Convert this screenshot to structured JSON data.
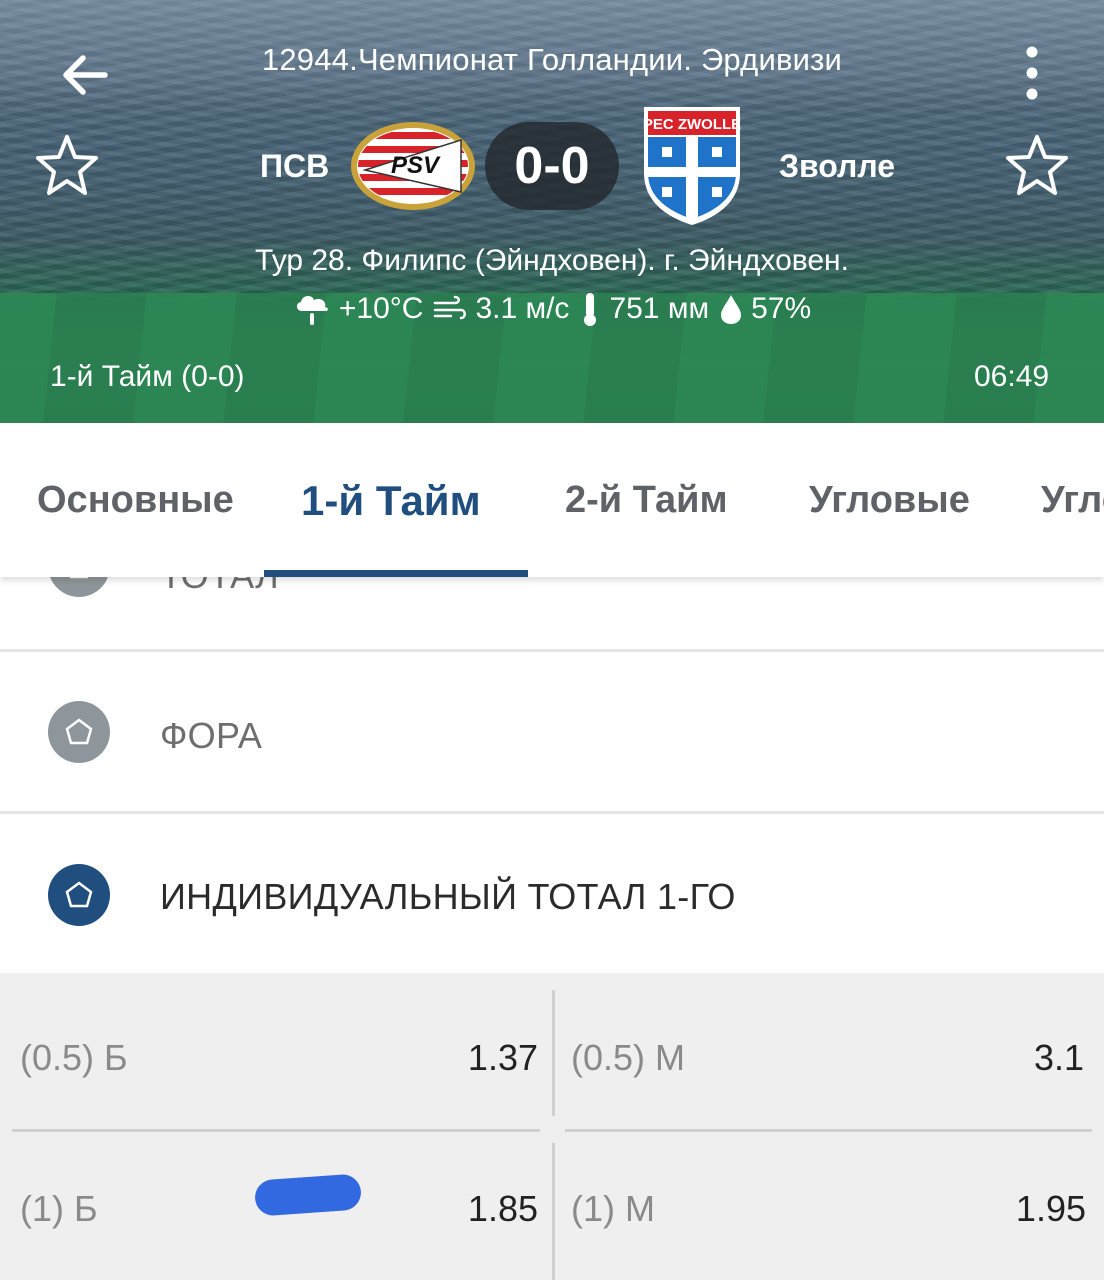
{
  "header": {
    "league": "12944.Чемпионат Голландии. Эрдивизи",
    "home_team": "ПСВ",
    "away_team": "Зволле",
    "home_logo_text": "PSV",
    "away_logo_text": "PEC ZWOLLE",
    "score": "0-0",
    "venue": "Тур 28. Филипс (Эйндховен). г. Эйндховен.",
    "weather": {
      "temperature": "+10°C",
      "wind": "3.1 м/с",
      "pressure": "751 мм",
      "humidity": "57%"
    },
    "period": "1-й  Тайм (0-0)",
    "time": "06:49",
    "icons": [
      "back-arrow-icon",
      "more-vert-icon",
      "star-outline-icon",
      "cloud-rain-icon",
      "wind-icon",
      "thermometer-icon",
      "drop-icon"
    ]
  },
  "tabs": [
    {
      "label": "Основные",
      "active": false
    },
    {
      "label": "1-й  Тайм",
      "active": true
    },
    {
      "label": "2-й  Тайм",
      "active": false
    },
    {
      "label": "Угловые",
      "active": false
    },
    {
      "label": "Угло",
      "active": false
    }
  ],
  "markets": [
    {
      "label": "ТОТАЛ",
      "expanded": false
    },
    {
      "label": "ФОРА",
      "expanded": false
    },
    {
      "label": "ИНДИВИДУАЛЬНЫЙ ТОТАЛ 1-ГО",
      "expanded": true
    }
  ],
  "odds": [
    {
      "label": "(0.5) Б",
      "value": "1.37"
    },
    {
      "label": "(0.5) М",
      "value": "3.1"
    },
    {
      "label": "(1) Б",
      "value": "1.85"
    },
    {
      "label": "(1) М",
      "value": "1.95"
    }
  ],
  "colors": {
    "accent": "#1f4e7f",
    "marker": "#3268e0",
    "odds_bg": "#efefef",
    "inactive_icon": "#8f969b"
  }
}
